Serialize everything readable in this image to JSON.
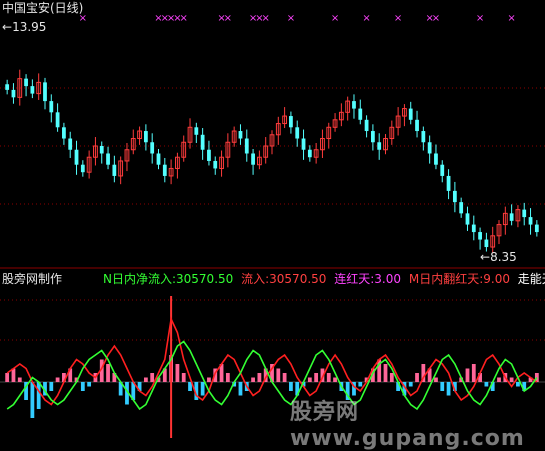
{
  "title": "中国宝安(日线)",
  "price_high_label": "13.95",
  "price_low_label": "8.35",
  "indicator": {
    "name": "股旁网制作",
    "items": [
      {
        "text": "N日内净流入:30570.50",
        "color": "#33ff33"
      },
      {
        "text": "流入:30570.50",
        "color": "#ff4040"
      },
      {
        "text": "连红天:3.00",
        "color": "#ff44ff"
      },
      {
        "text": "M日内翻红天:9.00",
        "color": "#ff4040"
      },
      {
        "text": "走能天:",
        "color": "#ffffff"
      }
    ]
  },
  "watermark": "股旁网 www.gupang.com",
  "colors": {
    "up": "#ff3c3c",
    "down": "#54ffff",
    "magenta": "#ff44ff",
    "grid": "#8b0000",
    "bar_pos": "#ff6699",
    "bar_neg": "#33ccff",
    "line_red": "#ff2020",
    "line_green": "#33ff33",
    "spike": "#ff3333"
  },
  "chart_data": [
    {
      "type": "candlestick",
      "title": "中国宝安(日线)",
      "ylim": [
        8.0,
        14.2
      ],
      "high": 13.95,
      "low": 8.35,
      "close": [
        12.6,
        12.4,
        12.9,
        12.7,
        12.5,
        12.8,
        12.3,
        12.0,
        11.6,
        11.3,
        11.0,
        10.6,
        10.4,
        10.8,
        11.1,
        10.9,
        10.6,
        10.3,
        10.7,
        11.0,
        11.3,
        11.5,
        11.2,
        10.9,
        10.6,
        10.3,
        10.5,
        10.8,
        11.2,
        11.6,
        11.4,
        11.0,
        10.7,
        10.5,
        10.8,
        11.2,
        11.5,
        11.3,
        10.9,
        10.6,
        10.8,
        11.1,
        11.4,
        11.7,
        11.9,
        11.6,
        11.3,
        11.0,
        10.8,
        11.0,
        11.3,
        11.6,
        11.8,
        12.0,
        12.3,
        12.1,
        11.8,
        11.5,
        11.2,
        11.0,
        11.3,
        11.6,
        11.9,
        12.1,
        11.8,
        11.5,
        11.2,
        10.9,
        10.6,
        10.3,
        9.9,
        9.6,
        9.3,
        9.0,
        8.8,
        8.6,
        8.4,
        8.7,
        9.0,
        9.3,
        9.1,
        9.4,
        9.2,
        9.0,
        8.8
      ],
      "markers_top": [
        12,
        24,
        25,
        26,
        27,
        28,
        34,
        35,
        39,
        40,
        41,
        45,
        52,
        57,
        62,
        67,
        68,
        75,
        80
      ]
    },
    {
      "type": "bar+line",
      "series": [
        {
          "name": "N日内净流入",
          "values": [
            0.2,
            0.3,
            0.1,
            -0.4,
            -0.8,
            -0.6,
            -0.3,
            -0.2,
            0.1,
            0.2,
            0.3,
            0.1,
            -0.2,
            -0.1,
            0.2,
            0.5,
            0.4,
            0.2,
            -0.3,
            -0.5,
            -0.4,
            -0.2,
            0.1,
            0.2,
            0.1,
            0.3,
            0.6,
            0.4,
            0.2,
            -0.2,
            -0.4,
            -0.3,
            0.1,
            0.3,
            0.4,
            0.2,
            -0.1,
            -0.3,
            -0.2,
            0.1,
            0.2,
            0.3,
            0.4,
            0.3,
            0.2,
            -0.2,
            -0.3,
            -0.1,
            0.1,
            0.2,
            0.3,
            0.2,
            0.1,
            -0.2,
            -0.4,
            -0.3,
            -0.1,
            0.1,
            0.3,
            0.5,
            0.4,
            0.2,
            -0.2,
            -0.3,
            -0.1,
            0.2,
            0.4,
            0.3,
            0.1,
            -0.2,
            -0.3,
            -0.2,
            0.1,
            0.3,
            0.4,
            0.2,
            -0.1,
            -0.2,
            0.1,
            0.2,
            0.1,
            -0.1,
            -0.2,
            0.1,
            0.2
          ]
        },
        {
          "name": "流入",
          "values": [
            0.2,
            0.3,
            0.4,
            0.3,
            0.0,
            -0.2,
            -0.4,
            -0.5,
            -0.3,
            0.0,
            0.3,
            0.5,
            0.4,
            0.2,
            0.1,
            0.3,
            0.6,
            0.8,
            0.6,
            0.3,
            0.0,
            -0.2,
            -0.3,
            -0.1,
            0.2,
            0.5,
            1.4,
            1.1,
            0.5,
            0.1,
            -0.3,
            -0.4,
            -0.2,
            0.2,
            0.4,
            0.6,
            0.5,
            0.2,
            -0.1,
            -0.3,
            -0.2,
            0.1,
            0.3,
            0.5,
            0.6,
            0.4,
            0.1,
            -0.1,
            -0.3,
            -0.2,
            0.1,
            0.4,
            0.6,
            0.4,
            0.1,
            -0.1,
            -0.2,
            0.0,
            0.3,
            0.5,
            0.6,
            0.4,
            0.1,
            -0.1,
            -0.3,
            -0.2,
            0.1,
            0.3,
            0.5,
            0.4,
            0.2,
            -0.2,
            -0.4,
            -0.3,
            -0.1,
            0.2,
            0.5,
            0.6,
            0.4,
            0.1,
            -0.1,
            0.1,
            0.2,
            0.1,
            0.0
          ]
        },
        {
          "name": "走能",
          "values": [
            -0.6,
            -0.5,
            -0.3,
            -0.1,
            0.1,
            0.0,
            -0.2,
            -0.4,
            -0.5,
            -0.4,
            -0.2,
            0.0,
            0.3,
            0.5,
            0.6,
            0.7,
            0.5,
            0.2,
            0.0,
            -0.2,
            -0.4,
            -0.6,
            -0.5,
            -0.2,
            0.1,
            0.3,
            0.5,
            0.8,
            0.9,
            0.7,
            0.4,
            0.1,
            -0.2,
            -0.4,
            -0.5,
            -0.3,
            0.0,
            0.2,
            0.5,
            0.7,
            0.6,
            0.3,
            0.0,
            -0.2,
            -0.4,
            -0.5,
            -0.3,
            0.0,
            0.3,
            0.6,
            0.7,
            0.5,
            0.2,
            -0.1,
            -0.3,
            -0.5,
            -0.4,
            -0.1,
            0.2,
            0.4,
            0.5,
            0.3,
            0.0,
            -0.3,
            -0.5,
            -0.6,
            -0.4,
            -0.1,
            0.2,
            0.5,
            0.6,
            0.4,
            0.1,
            -0.2,
            -0.4,
            -0.5,
            -0.3,
            0.0,
            0.3,
            0.5,
            0.4,
            0.1,
            -0.2,
            -0.1,
            0.1
          ]
        }
      ]
    }
  ]
}
